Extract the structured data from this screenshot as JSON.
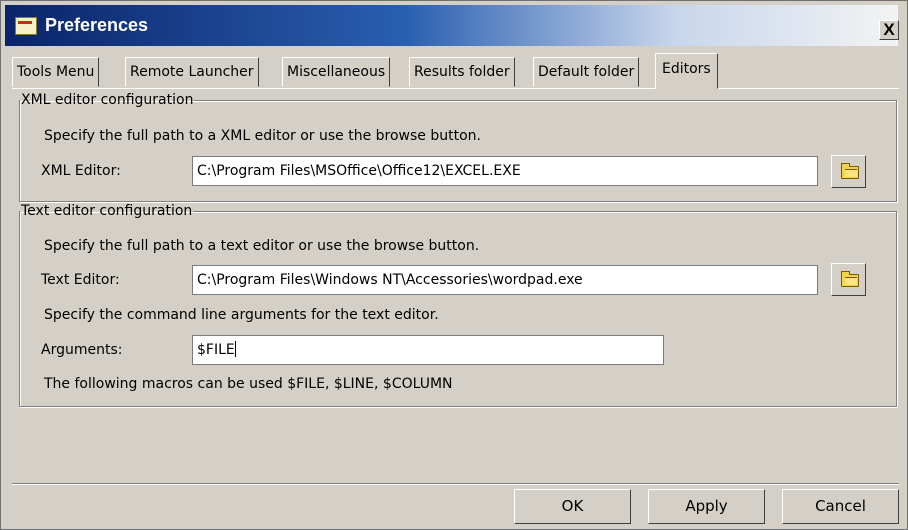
{
  "window": {
    "title": "Preferences",
    "close_glyph": "X"
  },
  "tabs": [
    {
      "label": "Tools Menu"
    },
    {
      "label": "Remote Launcher"
    },
    {
      "label": "Miscellaneous"
    },
    {
      "label": "Results folder"
    },
    {
      "label": "Default folder"
    },
    {
      "label": "Editors",
      "active": true
    }
  ],
  "xml_group": {
    "legend": "XML editor configuration",
    "description": "Specify the full path to a XML editor or use the browse button.",
    "label": "XML Editor:",
    "value": "C:\\Program Files\\MSOffice\\Office12\\EXCEL.EXE",
    "browse_icon": "folder-icon"
  },
  "text_group": {
    "legend": "Text editor configuration",
    "description": "Specify the full path to a text editor or use the browse button.",
    "label": "Text Editor:",
    "value": "C:\\Program Files\\Windows NT\\Accessories\\wordpad.exe",
    "browse_icon": "folder-icon",
    "args_description": "Specify the command line arguments for the text editor.",
    "args_label": "Arguments:",
    "args_value": "$FILE",
    "macros_note": "The following macros can be used $FILE, $LINE, $COLUMN"
  },
  "buttons": {
    "ok": "OK",
    "apply": "Apply",
    "cancel": "Cancel"
  },
  "colors": {
    "titlebar_start": "#0a246a",
    "face": "#d4d0c8"
  }
}
